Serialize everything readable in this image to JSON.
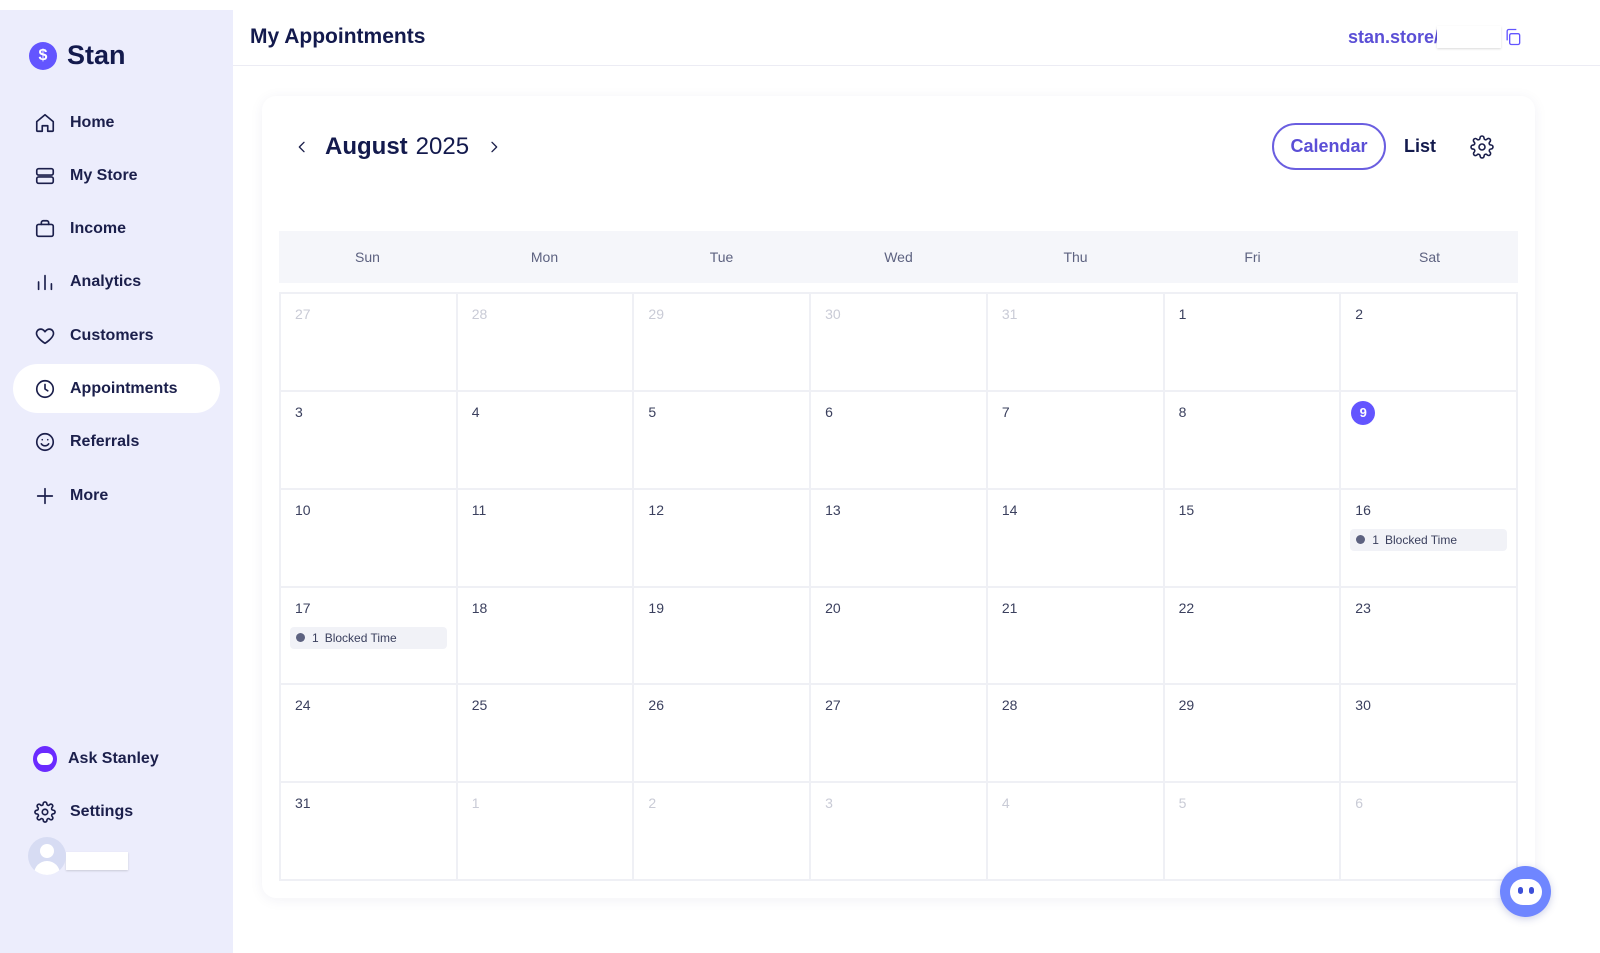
{
  "brand": {
    "name": "Stan",
    "logo_glyph": "$"
  },
  "sidebar": {
    "items": [
      {
        "label": "Home",
        "icon": "home-icon",
        "active": false
      },
      {
        "label": "My Store",
        "icon": "store-icon",
        "active": false
      },
      {
        "label": "Income",
        "icon": "wallet-icon",
        "active": false
      },
      {
        "label": "Analytics",
        "icon": "bar-chart-icon",
        "active": false
      },
      {
        "label": "Customers",
        "icon": "heart-icon",
        "active": false
      },
      {
        "label": "Appointments",
        "icon": "clock-icon",
        "active": true
      },
      {
        "label": "Referrals",
        "icon": "smile-icon",
        "active": false
      },
      {
        "label": "More",
        "icon": "plus-icon",
        "active": false
      }
    ],
    "bottom": [
      {
        "label": "Ask Stanley",
        "icon": "stanley-bot-icon"
      },
      {
        "label": "Settings",
        "icon": "gear-icon"
      }
    ]
  },
  "header": {
    "title": "My Appointments",
    "store_link": "stan.store/"
  },
  "calendar": {
    "month": "August",
    "year": "2025",
    "view_calendar_label": "Calendar",
    "view_list_label": "List",
    "weekdays": [
      "Sun",
      "Mon",
      "Tue",
      "Wed",
      "Thu",
      "Fri",
      "Sat"
    ],
    "days": [
      {
        "n": "27",
        "muted": true
      },
      {
        "n": "28",
        "muted": true
      },
      {
        "n": "29",
        "muted": true
      },
      {
        "n": "30",
        "muted": true
      },
      {
        "n": "31",
        "muted": true
      },
      {
        "n": "1"
      },
      {
        "n": "2"
      },
      {
        "n": "3"
      },
      {
        "n": "4"
      },
      {
        "n": "5"
      },
      {
        "n": "6"
      },
      {
        "n": "7"
      },
      {
        "n": "8"
      },
      {
        "n": "9",
        "today": true
      },
      {
        "n": "10"
      },
      {
        "n": "11"
      },
      {
        "n": "12"
      },
      {
        "n": "13"
      },
      {
        "n": "14"
      },
      {
        "n": "15"
      },
      {
        "n": "16",
        "event": {
          "count": "1",
          "label": "Blocked Time"
        }
      },
      {
        "n": "17",
        "event": {
          "count": "1",
          "label": "Blocked Time"
        }
      },
      {
        "n": "18"
      },
      {
        "n": "19"
      },
      {
        "n": "20"
      },
      {
        "n": "21"
      },
      {
        "n": "22"
      },
      {
        "n": "23"
      },
      {
        "n": "24"
      },
      {
        "n": "25"
      },
      {
        "n": "26"
      },
      {
        "n": "27"
      },
      {
        "n": "28"
      },
      {
        "n": "29"
      },
      {
        "n": "30"
      },
      {
        "n": "31"
      },
      {
        "n": "1",
        "muted": true
      },
      {
        "n": "2",
        "muted": true
      },
      {
        "n": "3",
        "muted": true
      },
      {
        "n": "4",
        "muted": true
      },
      {
        "n": "5",
        "muted": true
      },
      {
        "n": "6",
        "muted": true
      }
    ]
  },
  "colors": {
    "accent": "#6355ff",
    "sidebar_bg": "#ecedfc",
    "text_dark": "#131a4d"
  }
}
